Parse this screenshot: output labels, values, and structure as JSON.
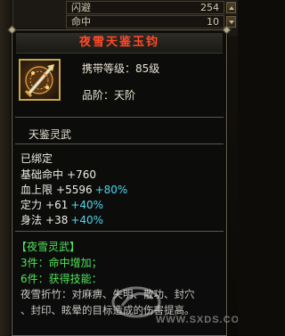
{
  "background_stats": {
    "rows": [
      {
        "label": "闪避",
        "value": "254"
      },
      {
        "label": "命中",
        "value": "10"
      }
    ]
  },
  "item": {
    "title": "夜雪天鉴玉钧",
    "icon": "sword-emblem-icon",
    "required_level": "携带等级：85级",
    "grade": "品阶：天阶",
    "type_name": "天鉴灵武",
    "bound_status": "已绑定",
    "stats": [
      {
        "label": "基础命中",
        "value": "+760",
        "percent": ""
      },
      {
        "label": "血上限",
        "value": "+5596",
        "percent": "+80%"
      },
      {
        "label": "定力",
        "value": "+61",
        "percent": "+40%"
      },
      {
        "label": "身法",
        "value": "+38",
        "percent": "+40%"
      }
    ],
    "set_name": "【夜雪灵武】",
    "set_bonuses": [
      "3件：命中增加；",
      "6件：获得技能："
    ],
    "skill_description_line1": "夜雪折竹：对麻痹、失明、散功、封穴",
    "skill_description_line2": "、封印、眩晕的目标造成的伤害提高。"
  },
  "watermark": {
    "logo_text": "WWW.SXDS.COM"
  },
  "colors": {
    "title": "#ff4a2a",
    "set_text": "#53e35a",
    "percent_bonus": "#4fd6ef",
    "frame_gold": "#c8a64a"
  }
}
